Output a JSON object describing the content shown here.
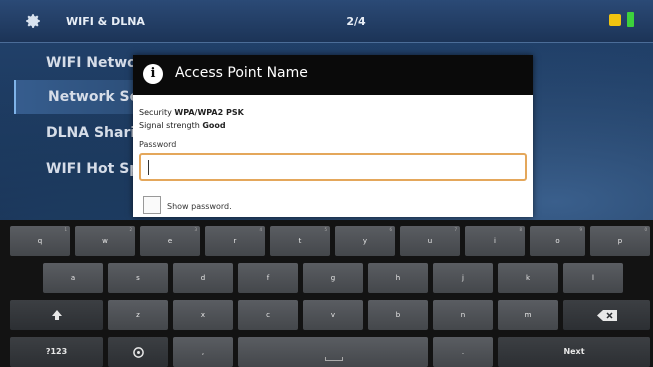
{
  "topbar": {
    "title": "WIFI & DLNA",
    "page": "2/4",
    "gear_icon": "gear-icon",
    "warning_icon": "warning-icon",
    "battery_icon": "battery-icon"
  },
  "menu": {
    "items": [
      {
        "label": "WIFI Networ",
        "selected": false
      },
      {
        "label": "Network Set",
        "selected": true
      },
      {
        "label": "DLNA Sharin",
        "selected": false
      },
      {
        "label": "WIFI Hot Sp",
        "selected": false
      }
    ]
  },
  "dialog": {
    "title": "Access Point Name",
    "info_icon": "info-icon",
    "security_label": "Security",
    "security_value": "WPA/WPA2 PSK",
    "signal_label": "Signal strength",
    "signal_value": "Good",
    "password_label": "Password",
    "password_value": "",
    "show_password_label": "Show password."
  },
  "keyboard": {
    "row1": [
      "q",
      "w",
      "e",
      "r",
      "t",
      "y",
      "u",
      "i",
      "o",
      "p"
    ],
    "row1_hints": [
      "1",
      "2",
      "3",
      "4",
      "5",
      "6",
      "7",
      "8",
      "9",
      "0"
    ],
    "row2": [
      "a",
      "s",
      "d",
      "f",
      "g",
      "h",
      "j",
      "k",
      "l"
    ],
    "row3": [
      "z",
      "x",
      "c",
      "v",
      "b",
      "n",
      "m"
    ],
    "shift_icon": "shift-icon",
    "delete_icon": "backspace-icon",
    "symbols_label": "?123",
    "settings_icon": "settings-icon",
    "comma_label": ",",
    "period_label": ".",
    "space_icon": "space-icon",
    "next_label": "Next"
  },
  "colors": {
    "accent_focus": "#e4a75b",
    "dialog_header": "#0a0a0a",
    "battery": "#3cd23c",
    "warning": "#f1c40f"
  }
}
